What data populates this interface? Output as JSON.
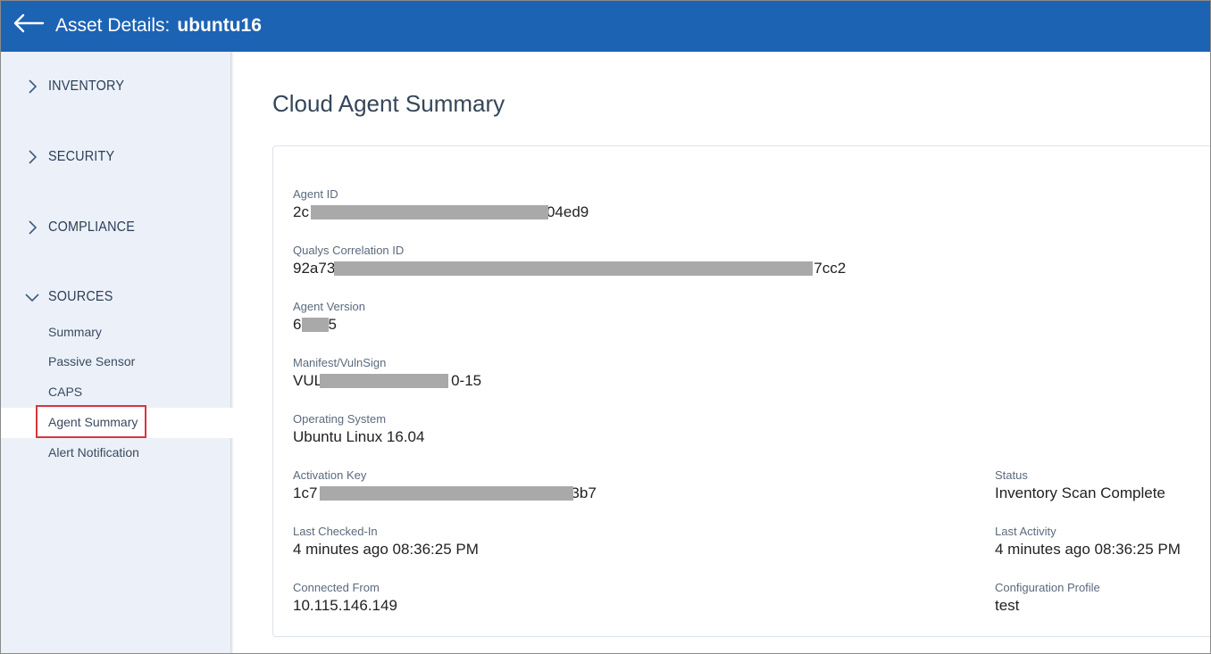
{
  "header": {
    "title_prefix": "Asset Details:",
    "asset_name": "ubuntu16",
    "back_icon": "arrow-left-icon"
  },
  "sidebar": {
    "sections": [
      {
        "label": "INVENTORY",
        "expanded": false
      },
      {
        "label": "SECURITY",
        "expanded": false
      },
      {
        "label": "COMPLIANCE",
        "expanded": false
      },
      {
        "label": "SOURCES",
        "expanded": true
      }
    ],
    "sources_items": [
      {
        "label": "Summary"
      },
      {
        "label": "Passive Sensor"
      },
      {
        "label": "CAPS"
      },
      {
        "label": "Agent Summary",
        "active": true
      },
      {
        "label": "Alert Notification"
      }
    ]
  },
  "main": {
    "title": "Cloud Agent Summary",
    "fields": {
      "agent_id": {
        "label": "Agent ID",
        "value_start": "2c",
        "value_end": "04ed9"
      },
      "correlation_id": {
        "label": "Qualys Correlation ID",
        "value_start": "92a73",
        "value_end": "7cc2"
      },
      "agent_version": {
        "label": "Agent Version",
        "value_start": "6",
        "value_end": "5"
      },
      "manifest": {
        "label": "Manifest/VulnSign",
        "value_start": "VUL",
        "value_end": "0-15"
      },
      "os": {
        "label": "Operating System",
        "value": "Ubuntu Linux 16.04"
      },
      "activation_key": {
        "label": "Activation Key",
        "value_start": "1c7",
        "value_end": "3b7"
      },
      "last_checked_in": {
        "label": "Last Checked-In",
        "value": "4 minutes ago 08:36:25 PM"
      },
      "connected_from": {
        "label": "Connected From",
        "value": "10.115.146.149"
      },
      "status": {
        "label": "Status",
        "value": "Inventory Scan Complete"
      },
      "last_activity": {
        "label": "Last Activity",
        "value": "4 minutes ago 08:36:25 PM"
      },
      "config_profile": {
        "label": "Configuration Profile",
        "value": "test"
      }
    }
  },
  "colors": {
    "header_bg": "#1d63b4",
    "sidebar_bg": "#ecf1f9",
    "active_outline": "#d9363e",
    "redaction": "#a9a9a9"
  }
}
